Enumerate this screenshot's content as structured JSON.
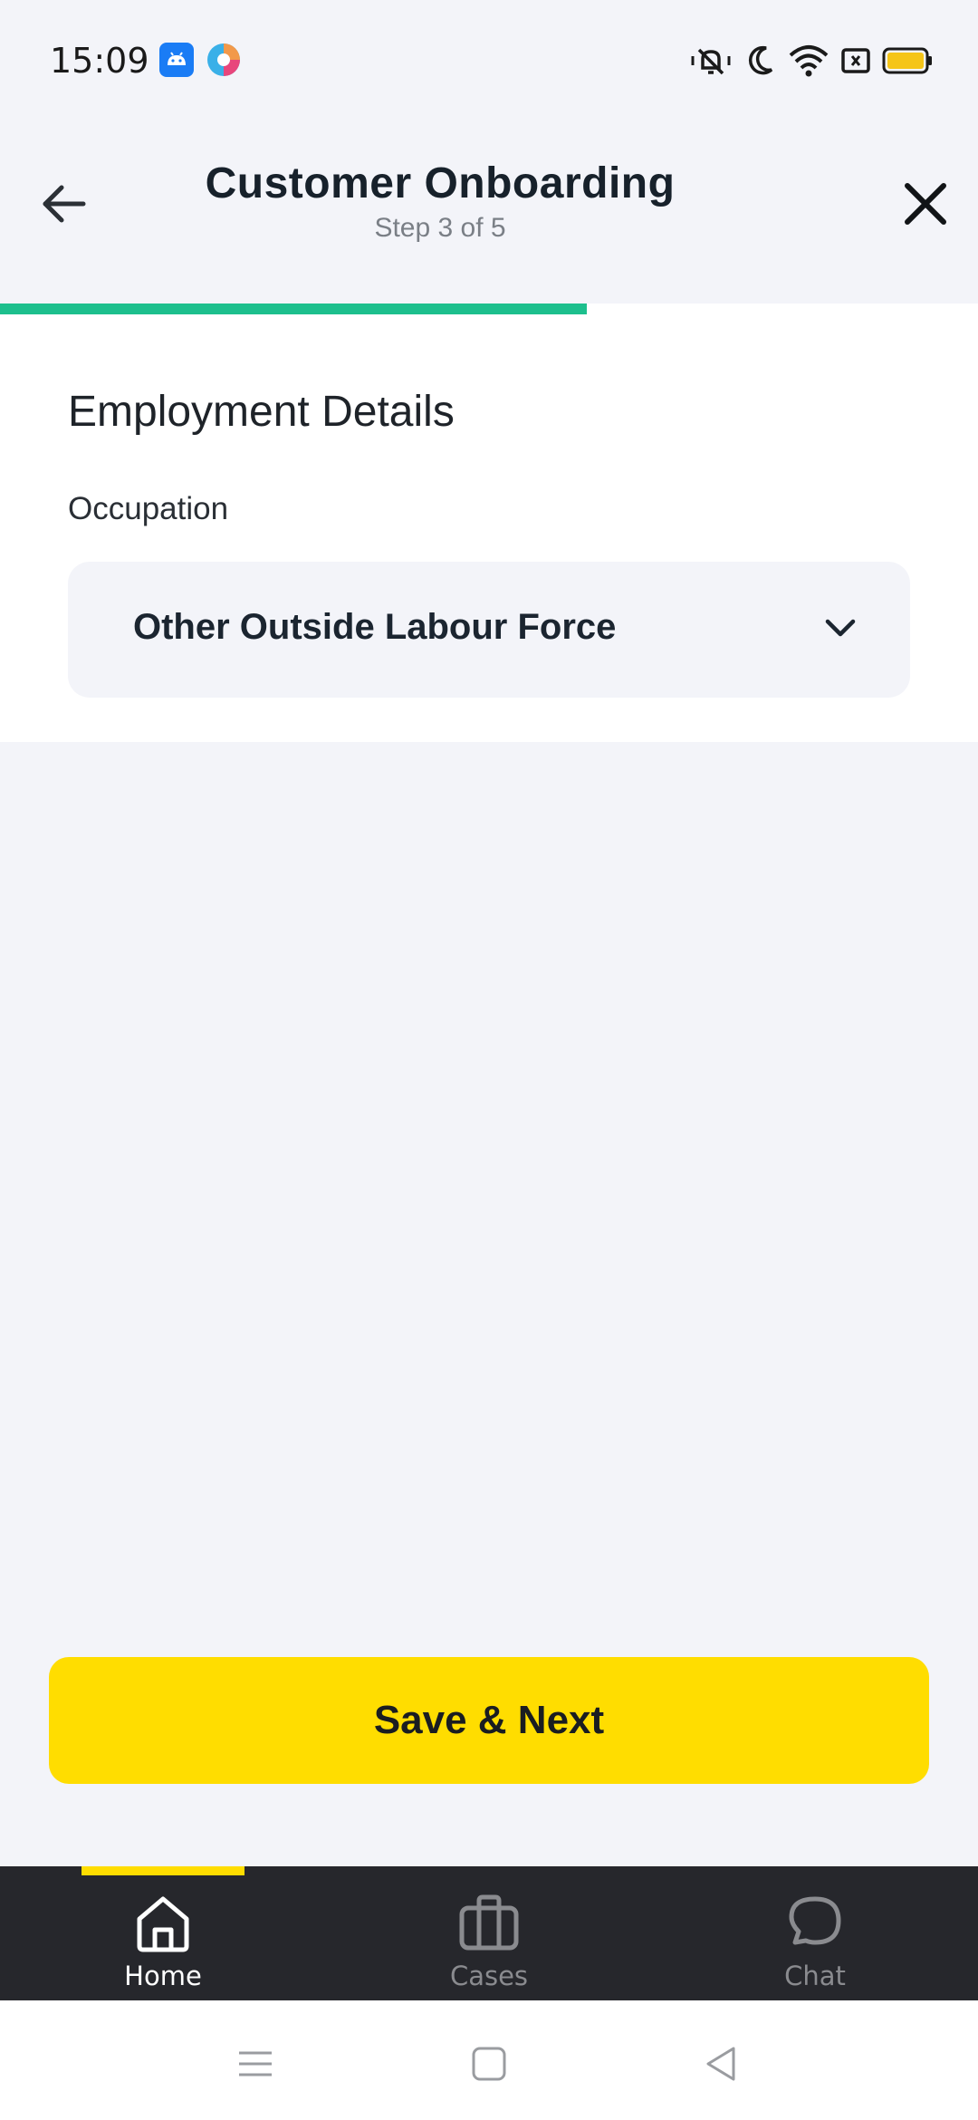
{
  "status_bar": {
    "time": "15:09",
    "icons": [
      "android-icon",
      "browser-app-icon",
      "vibrate-mute-icon",
      "moon-icon",
      "wifi-icon",
      "sim-card-icon",
      "battery-icon"
    ],
    "battery_color": "#f5c518"
  },
  "header": {
    "title": "Customer Onboarding",
    "subtitle": "Step 3 of 5",
    "back_icon": "arrow-left-icon",
    "close_icon": "close-icon"
  },
  "progress": {
    "current_step": 3,
    "total_steps": 5,
    "fraction": 0.6,
    "color": "#1dbf8d"
  },
  "form": {
    "section_title": "Employment Details",
    "occupation": {
      "label": "Occupation",
      "value": "Other Outside Labour Force",
      "icon": "chevron-down-icon"
    }
  },
  "actions": {
    "save_next_label": "Save & Next",
    "accent_color": "#ffdd00"
  },
  "bottom_nav": {
    "items": [
      {
        "label": "Home",
        "icon": "home-icon",
        "active": true
      },
      {
        "label": "Cases",
        "icon": "briefcase-icon",
        "active": false
      },
      {
        "label": "Chat",
        "icon": "chat-bubble-icon",
        "active": false
      }
    ],
    "active_color": "#ffffff",
    "inactive_color": "#8a8b8f"
  },
  "system_nav": {
    "icons": [
      "menu-icon",
      "home-square-icon",
      "back-triangle-icon"
    ]
  }
}
